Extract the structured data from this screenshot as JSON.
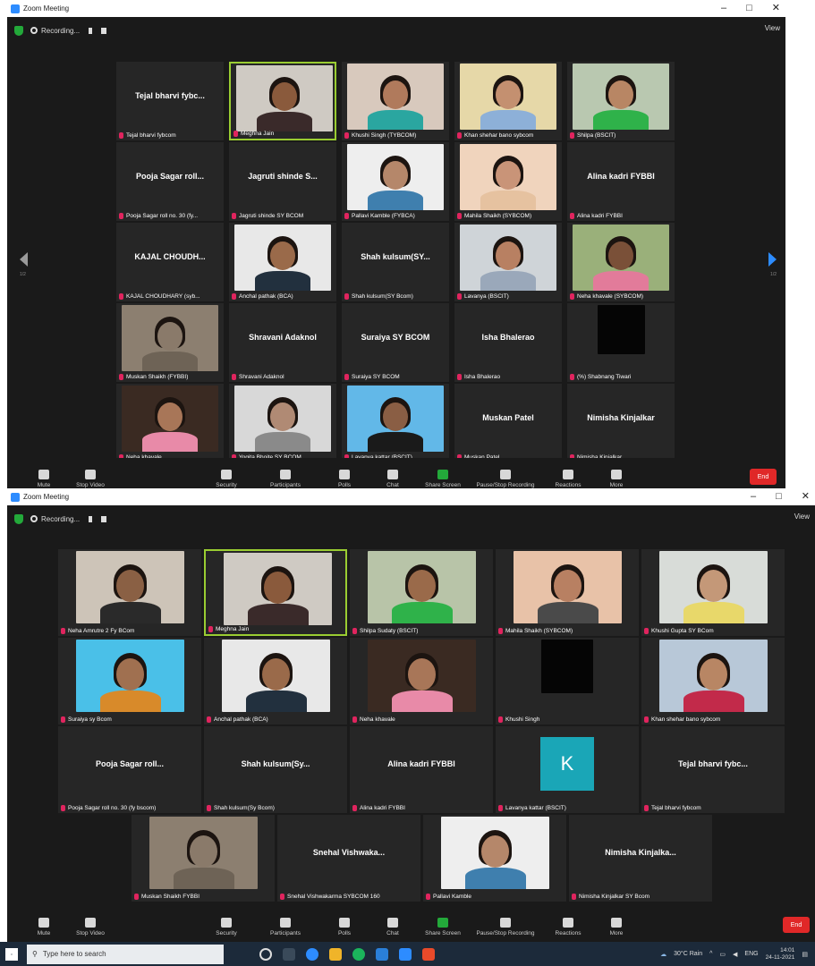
{
  "window_title": "Zoom Meeting",
  "recording_label": "Recording...",
  "view_label": "View",
  "window_controls": [
    "–",
    "□",
    "✕"
  ],
  "nav": {
    "left_page": "1/2",
    "right_page": "1/2"
  },
  "toolbar": {
    "mute": "Mute",
    "stop_video": "Stop Video",
    "security": "Security",
    "participants": "Participants",
    "participants_count": "31",
    "polls": "Polls",
    "chat": "Chat",
    "share_screen": "Share Screen",
    "pause_recording": "Pause/Stop Recording",
    "reactions": "Reactions",
    "more": "More",
    "end": "End"
  },
  "screenshot1": {
    "tiles": [
      {
        "display": "Tejal bharvi fybc...",
        "label": "Tejal bharvi fybcom",
        "video": false
      },
      {
        "display": "",
        "label": "Meghna Jain",
        "video": true,
        "active": true,
        "skin": "#8a5a3c",
        "bg": "#cfcac3",
        "top": "#3a2a2a"
      },
      {
        "display": "",
        "label": "Khushi Singh (TYBCOM)",
        "video": true,
        "skin": "#b07a5c",
        "bg": "#d8c9bd",
        "top": "#2aa6a0"
      },
      {
        "display": "",
        "label": "Khan shehar bano sybcom",
        "video": true,
        "skin": "#c49070",
        "bg": "#e6d8a8",
        "top": "#8db0d8"
      },
      {
        "display": "",
        "label": "Shilpa (BSCIT)",
        "video": true,
        "skin": "#b88664",
        "bg": "#b9c8b0",
        "top": "#2fb24a"
      },
      {
        "display": "Pooja Sagar roll...",
        "label": "Pooja Sagar roll no. 30 (fy...",
        "video": false
      },
      {
        "display": "Jagruti shinde S...",
        "label": "Jagruti shinde SY BCOM",
        "video": false
      },
      {
        "display": "",
        "label": "Pallavi Kamble (FYBCA)",
        "video": true,
        "skin": "#b5876a",
        "bg": "#eeeeee",
        "top": "#3f7fae"
      },
      {
        "display": "",
        "label": "Mahila Shaikh (SYBCOM)",
        "video": true,
        "skin": "#c99478",
        "bg": "#f0d4bd",
        "top": "#e6c2a0"
      },
      {
        "display": "Alina kadri FYBBI",
        "label": "Alina kadri FYBBI",
        "video": false
      },
      {
        "display": "KAJAL CHOUDH...",
        "label": "KAJAL CHOUDHARY (syb...",
        "video": false
      },
      {
        "display": "",
        "label": "Anchal pathak (BCA)",
        "video": true,
        "skin": "#9a6a4a",
        "bg": "#e8e8e8",
        "top": "#22303e"
      },
      {
        "display": "Shah kulsum(SY...",
        "label": "Shah kulsum(SY Bcom)",
        "video": false
      },
      {
        "display": "",
        "label": "Lavanya (BSCIT)",
        "video": true,
        "skin": "#b88062",
        "bg": "#cfd4d8",
        "top": "#9aa8ba"
      },
      {
        "display": "",
        "label": "Neha khavale (SYBCOM)",
        "video": true,
        "skin": "#7a5038",
        "bg": "#9ab07a",
        "top": "#e27b9a"
      },
      {
        "display": "",
        "label": "Muskan Shaikh (FYBBI)",
        "video": true,
        "skin": "#8a7a6a",
        "bg": "#8c7f70",
        "top": "#6e6356"
      },
      {
        "display": "Shravani Adaknol",
        "label": "Shravani Adaknol",
        "video": false
      },
      {
        "display": "Suraiya SY BCOM",
        "label": "Suraiya SY BCOM",
        "video": false
      },
      {
        "display": "Isha Bhalerao",
        "label": "Isha Bhalerao",
        "video": false
      },
      {
        "display": "",
        "label": "(%) Shabnang Tiwari",
        "video": true,
        "black": true
      },
      {
        "display": "",
        "label": "Neha khavale",
        "video": true,
        "skin": "#a87658",
        "bg": "#3a2a22",
        "top": "#e88aa8"
      },
      {
        "display": "",
        "label": "Yogita Bhoite SY BCOM",
        "video": true,
        "skin": "#b08a74",
        "bg": "#d8d8d8",
        "top": "#8a8a8a"
      },
      {
        "display": "",
        "label": "Lavanya kattar (BSCIT)",
        "video": true,
        "skin": "#8a5e44",
        "bg": "#62b8e8",
        "top": "#1a1a1a"
      },
      {
        "display": "Muskan Patel",
        "label": "Muskan Patel",
        "video": false
      },
      {
        "display": "Nimisha Kinjalkar",
        "label": "Nimisha Kinjalkar",
        "video": false
      }
    ]
  },
  "screenshot2": {
    "row1": [
      {
        "display": "",
        "label": "Neha Amrutre 2 Fy BCom",
        "video": true,
        "skin": "#8a6044",
        "bg": "#cdc4b8",
        "top": "#2a2a2a"
      },
      {
        "display": "",
        "label": "Meghna Jain",
        "video": true,
        "active": true,
        "skin": "#8a5a3c",
        "bg": "#cfcac3",
        "top": "#3a2a2a"
      },
      {
        "display": "",
        "label": "Shilpa Sudaty (BSCIT)",
        "video": true,
        "skin": "#9a6a4a",
        "bg": "#b8c4a8",
        "top": "#2fb24a"
      },
      {
        "display": "",
        "label": "Mahila Shaikh (SYBCOM)",
        "video": true,
        "skin": "#b88062",
        "bg": "#e8c2a8",
        "top": "#4a4a4a"
      },
      {
        "display": "",
        "label": "Khushi Gupta SY BCom",
        "video": true,
        "skin": "#c49878",
        "bg": "#d8dcd8",
        "top": "#e8d86a"
      }
    ],
    "row2": [
      {
        "display": "",
        "label": "Suraiya sy Bcom",
        "video": true,
        "skin": "#a07050",
        "bg": "#4ac0e8",
        "top": "#d88a2a"
      },
      {
        "display": "",
        "label": "Anchal pathak (BCA)",
        "video": true,
        "skin": "#9a6a4a",
        "bg": "#e8e8e8",
        "top": "#22303e"
      },
      {
        "display": "",
        "label": "Neha khavale",
        "video": true,
        "skin": "#a87658",
        "bg": "#3a2a22",
        "top": "#e88aa8"
      },
      {
        "display": "",
        "label": "Khushi Singh",
        "video": true,
        "black": true
      },
      {
        "display": "",
        "label": "Khan shehar bano sybcom",
        "video": true,
        "skin": "#b88664",
        "bg": "#b8c8d8",
        "top": "#c22a4a"
      }
    ],
    "row3": [
      {
        "display": "Pooja Sagar roll...",
        "label": "Pooja Sagar roll no. 30 (fy bscom)",
        "video": false
      },
      {
        "display": "Shah kulsum(Sy...",
        "label": "Shah kulsum(Sy Bcom)",
        "video": false
      },
      {
        "display": "Alina kadri FYBBI",
        "label": "Alina kadri FYBBI",
        "video": false
      },
      {
        "display": "",
        "label": "Lavanya kattar (BSCIT)",
        "video": false,
        "avatar": "K"
      },
      {
        "display": "Tejal bharvi fybc...",
        "label": "Tejal bharvi fybcom",
        "video": false
      }
    ],
    "row4": [
      {
        "display": "",
        "label": "Muskan Shaikh FYBBI",
        "video": true,
        "skin": "#8a7a6a",
        "bg": "#8c7f70",
        "top": "#6e6356"
      },
      {
        "display": "Snehal Vishwaka...",
        "label": "Snehal Vishwakarma SYBCOM 160",
        "video": false
      },
      {
        "display": "",
        "label": "Pallavi Kamble",
        "video": true,
        "skin": "#b5876a",
        "bg": "#eeeeee",
        "top": "#3f7fae"
      },
      {
        "display": "Nimisha Kinjalka...",
        "label": "Nimisha Kinjalkar SY Bcom",
        "video": false
      }
    ]
  },
  "taskbar": {
    "search_placeholder": "Type here to search",
    "weather": "30°C Rain",
    "time": "14:01",
    "date": "24-11-2021"
  }
}
